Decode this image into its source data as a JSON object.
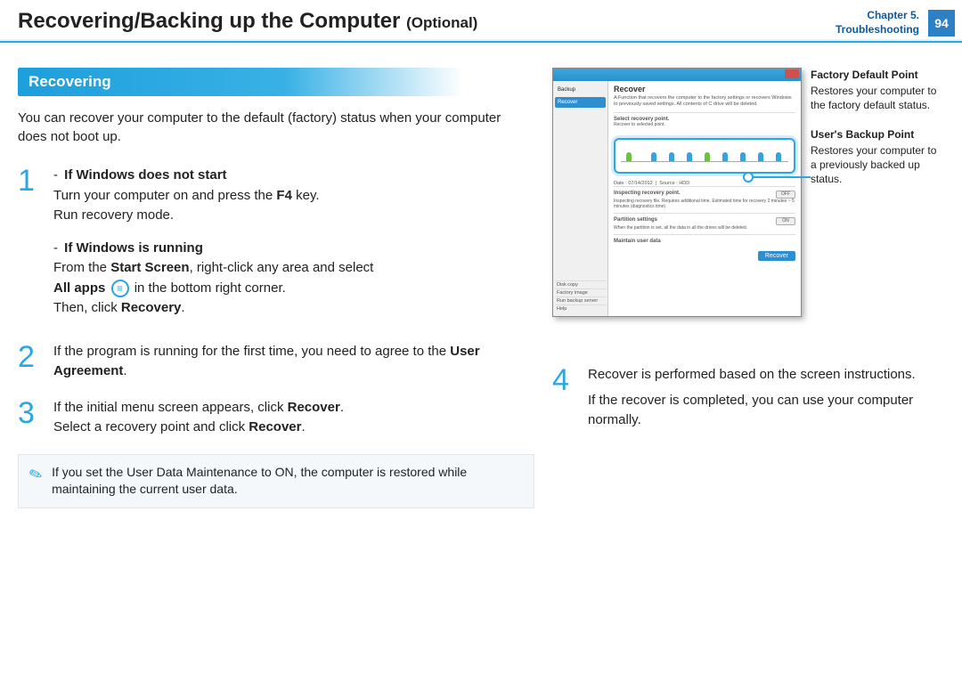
{
  "header": {
    "title_main": "Recovering/Backing up the Computer",
    "title_opt": "(Optional)",
    "chapter_line1": "Chapter 5.",
    "chapter_line2": "Troubleshooting",
    "page_num": "94"
  },
  "section_heading": "Recovering",
  "intro": "You can recover your computer to the default (factory) status when your computer does not boot up.",
  "step1": {
    "num": "1",
    "a_title": "If Windows does not start",
    "a_text1": "Turn your computer on and press the ",
    "a_key": "F4",
    "a_text2": " key.",
    "a_text3": "Run recovery mode.",
    "b_title": "If Windows is running",
    "b_text1": "From the ",
    "b_bold1": "Start Screen",
    "b_text2": ", right-click any area and select",
    "b_bold2": "All apps",
    "b_text3": " in the bottom right corner.",
    "b_text4": "Then, click ",
    "b_bold3": "Recovery",
    "b_text5": "."
  },
  "step2": {
    "num": "2",
    "text1": "If the program is running for the first time, you need to agree to the ",
    "bold": "User Agreement",
    "text2": "."
  },
  "step3": {
    "num": "3",
    "text1": "If the initial menu screen appears, click ",
    "bold1": "Recover",
    "text2": ".",
    "text3": "Select a recovery point and click ",
    "bold2": "Recover",
    "text4": "."
  },
  "note": "If you set the User Data Maintenance to ON, the computer is restored while maintaining the current user data.",
  "step4": {
    "num": "4",
    "text1": "Recover is performed based on the screen instructions.",
    "text2": "If the recover is completed, you can use your computer normally."
  },
  "callout1": {
    "title": "Factory Default Point",
    "text": "Restores your computer to the factory default status."
  },
  "callout2": {
    "title": "User's Backup Point",
    "text": "Restores your computer to a previously backed up status."
  },
  "shot": {
    "side_backup": "Backup",
    "side_recover": "Recover",
    "h": "Recover",
    "desc": "A Function that recovers the computer to the factory settings or recovers Windows to previously saved settings. All contents of C drive will be deleted.",
    "srp": "Select recovery point.",
    "srp2": "Recover to selected point.",
    "date_lbl": "Date :",
    "date_val": "07/14/2012",
    "src_lbl": "Source :",
    "src_val": "HDD",
    "irp": "Inspecting recovery point.",
    "irp_sub": "Inspecting recovery file. Requires additional time. Estimated time for recovery 2 minutes ~ 5 minutes (diagnostics time)",
    "ps": "Partition settings",
    "ps_sub": "When the partition is set, all the data in all the drives will be deleted.",
    "mud": "Maintain user data",
    "off": "OFF",
    "on": "ON",
    "btn": "Recover",
    "bs1": "Disk copy",
    "bs2": "Factory image",
    "bs3": "Run backup server",
    "bs4": "Help"
  }
}
